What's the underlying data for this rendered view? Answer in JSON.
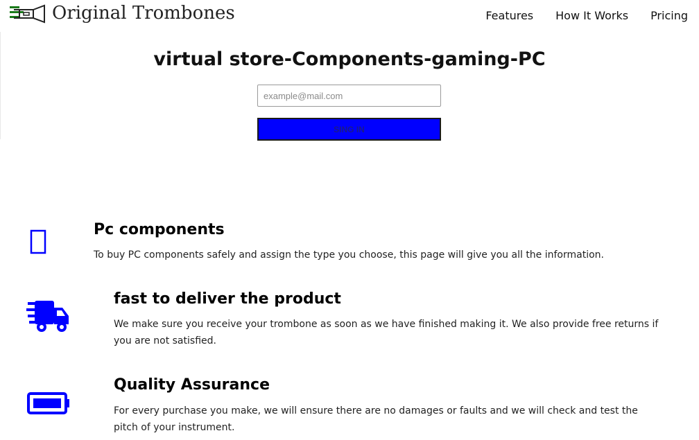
{
  "header": {
    "brand": "Original Trombones",
    "nav": [
      {
        "label": "Features"
      },
      {
        "label": "How It Works"
      },
      {
        "label": "Pricing"
      }
    ]
  },
  "hero": {
    "title": "virtual store-Components-gaming-PC",
    "email_placeholder": "example@mail.com",
    "signin_label": "SING IN"
  },
  "features": [
    {
      "icon": "missing-glyph-icon",
      "title": "Pc components",
      "text": "To buy PC components safely and assign the type you choose, this page will give you all the information."
    },
    {
      "icon": "shipping-truck-icon",
      "title": "fast to deliver the product",
      "text": "We make sure you receive your trombone as soon as we have finished making it. We also provide free returns if you are not satisfied."
    },
    {
      "icon": "battery-full-icon",
      "title": "Quality Assurance",
      "text": "For every purchase you make, we will ensure there are no damages or faults and we will check and test the pitch of your instrument."
    }
  ],
  "colors": {
    "accent": "#0000ff",
    "logo": "#1a7a1a"
  }
}
